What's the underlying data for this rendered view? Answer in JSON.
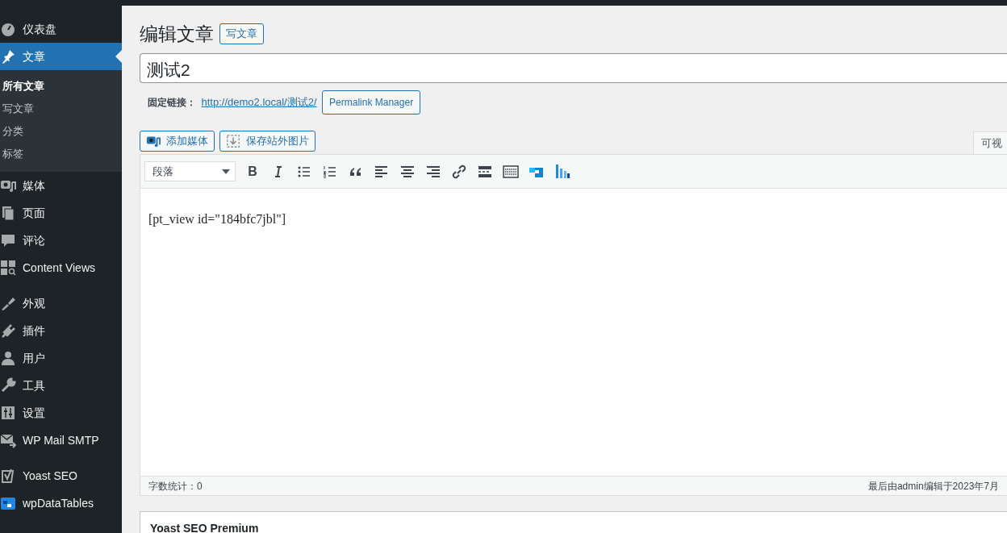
{
  "sidebar": {
    "items": [
      {
        "label": "仪表盘",
        "selected": false
      },
      {
        "label": "文章",
        "selected": true,
        "children": [
          {
            "label": "所有文章",
            "selected": true
          },
          {
            "label": "写文章",
            "selected": false
          },
          {
            "label": "分类",
            "selected": false
          },
          {
            "label": "标签",
            "selected": false
          }
        ]
      },
      {
        "label": "媒体",
        "selected": false
      },
      {
        "label": "页面",
        "selected": false
      },
      {
        "label": "评论",
        "selected": false
      },
      {
        "label": "Content Views",
        "selected": false
      },
      {
        "label": "外观",
        "selected": false
      },
      {
        "label": "插件",
        "selected": false
      },
      {
        "label": "用户",
        "selected": false
      },
      {
        "label": "工具",
        "selected": false
      },
      {
        "label": "设置",
        "selected": false
      },
      {
        "label": "WP Mail SMTP",
        "selected": false
      },
      {
        "label": "Yoast SEO",
        "selected": false
      },
      {
        "label": "wpDataTables",
        "selected": false
      }
    ]
  },
  "page": {
    "title": "编辑文章",
    "add_new": "写文章"
  },
  "post_title": "测试2",
  "permalink": {
    "label": "固定链接：",
    "url": "http://demo2.local/测试2/",
    "button": "Permalink Manager"
  },
  "media_buttons": [
    {
      "label": "添加媒体"
    },
    {
      "label": "保存站外图片"
    }
  ],
  "editor": {
    "tabs": [
      {
        "label": "可视",
        "selected": true
      }
    ],
    "format": "段落",
    "bold_button": "B",
    "content": "[pt_view id=\"184bfc7jbl\"]",
    "word_count": "字数统计：0",
    "last_edited": "最后由admin编辑于2023年7月"
  },
  "metabox": {
    "title": "Yoast SEO Premium"
  }
}
